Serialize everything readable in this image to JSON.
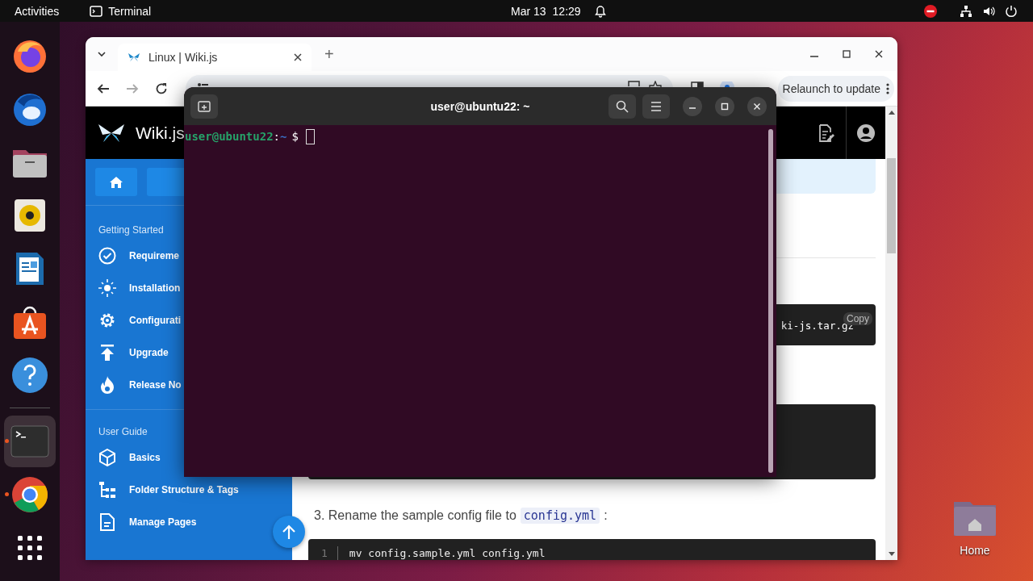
{
  "top_bar": {
    "activities": "Activities",
    "app_name": "Terminal",
    "date": "Mar 13",
    "time": "12:29"
  },
  "dock": {
    "favorites": [
      {
        "kind": "firefox",
        "running": false
      },
      {
        "kind": "thunderbird",
        "running": false
      },
      {
        "kind": "files",
        "running": false
      },
      {
        "kind": "rhythmbox",
        "running": false
      },
      {
        "kind": "writer",
        "running": false
      },
      {
        "kind": "software",
        "running": false
      },
      {
        "kind": "help",
        "running": false
      }
    ],
    "open_apps": [
      {
        "kind": "terminal",
        "running": true,
        "selected": true
      },
      {
        "kind": "chrome",
        "running": true,
        "selected": false
      }
    ]
  },
  "browser": {
    "tabs": [
      {
        "title": "Linux | Wiki.js",
        "selected": true
      }
    ],
    "new_tab": "+",
    "relaunch": "Relaunch to update"
  },
  "wiki": {
    "logo": "Wiki.js",
    "sidebar": [
      {
        "heading": "Getting Started",
        "items": [
          {
            "label": "Requireme",
            "kind": "check"
          },
          {
            "label": "Installation",
            "kind": "install"
          },
          {
            "label": "Configurati",
            "kind": "gear"
          },
          {
            "label": "Upgrade",
            "kind": "upgrade"
          },
          {
            "label": "Release No",
            "kind": "fire"
          }
        ]
      },
      {
        "heading": "User Guide",
        "items": [
          {
            "label": "Basics",
            "kind": "cube"
          },
          {
            "label": "Folder Structure & Tags",
            "kind": "tree"
          },
          {
            "label": "Manage Pages",
            "kind": "page"
          }
        ]
      }
    ],
    "content": {
      "code_tail": "ki-js.tar.gz",
      "copy": "Copy",
      "step": "3. Rename the sample config file to",
      "step_code": "config.yml",
      "step_end": ":",
      "line_number": "1",
      "code_line": "mv config.sample.yml config.yml"
    }
  },
  "terminal": {
    "title": "user@ubuntu22: ~",
    "prompt_user": "user@ubuntu22",
    "prompt_sep": ":",
    "prompt_dir": "~",
    "prompt_symbol": "$"
  },
  "desktop": {
    "home": "Home"
  }
}
